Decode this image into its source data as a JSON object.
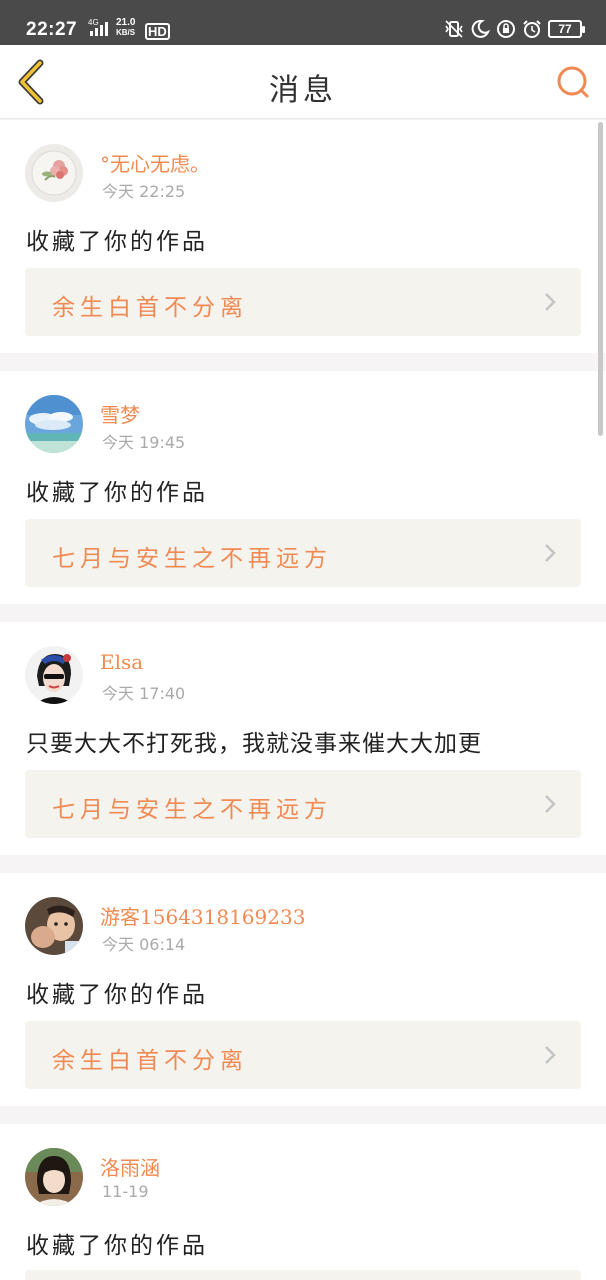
{
  "status_bar": {
    "time": "22:27",
    "network": "4G",
    "speed_value": "21.0",
    "speed_unit": "KB/S",
    "hd": "HD",
    "battery": "77"
  },
  "header": {
    "title": "消息"
  },
  "colors": {
    "accent": "#f08a52",
    "card_bg": "#ffffff",
    "work_bg": "#f4f3ee",
    "status_bar": "#4a4a4a"
  },
  "messages": [
    {
      "name": "°无心无虑。",
      "time": "今天 22:25",
      "text": "收藏了你的作品",
      "work_title": "余生白首不分离",
      "avatar": "flower-avatar"
    },
    {
      "name": "雪梦",
      "time": "今天 19:45",
      "text": "收藏了你的作品",
      "work_title": "七月与安生之不再远方",
      "avatar": "sky-avatar"
    },
    {
      "name": "Elsa",
      "time": "今天 17:40",
      "text": "只要大大不打死我，我就没事来催大大加更",
      "work_title": "七月与安生之不再远方",
      "avatar": "girl-avatar"
    },
    {
      "name": "游客1564318169233",
      "time": "今天 06:14",
      "text": "收藏了你的作品",
      "work_title": "余生白首不分离",
      "avatar": "child-avatar"
    },
    {
      "name": "洛雨涵",
      "time": "11-19",
      "text": "收藏了你的作品",
      "work_title": "",
      "avatar": "portrait-avatar"
    }
  ]
}
